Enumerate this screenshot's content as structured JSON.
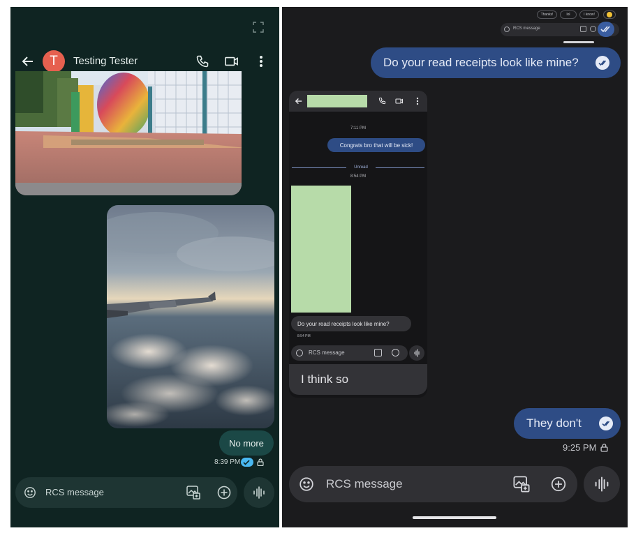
{
  "left": {
    "contact_initial": "T",
    "contact_name": "Testing Tester",
    "bubble_text": "No more",
    "timestamp": "8:39 PM",
    "composer_placeholder": "RCS message"
  },
  "right": {
    "suggestions": [
      "Thanks!",
      "lol",
      "I know!"
    ],
    "mini_composer_placeholder": "RCS message",
    "message1": "Do your read receipts look like mine?",
    "inner": {
      "time1": "7:11 PM",
      "sent_bubble": "Congrats bro that will be sick!",
      "unread_label": "Unread",
      "time2": "8:54 PM",
      "received_bubble": "Do your read receipts look like mine?",
      "received_time": "8:54 PM",
      "composer_placeholder": "RCS message"
    },
    "reply_text": "I think so",
    "message2": "They don't",
    "timestamp": "9:25 PM",
    "composer_placeholder": "RCS message"
  },
  "colors": {
    "left_bg": "#0f2422",
    "right_bg": "#1b1b1d",
    "blue_bubble": "#2e4c85",
    "avatar": "#e6604f",
    "redacted": "#b7dba9"
  }
}
